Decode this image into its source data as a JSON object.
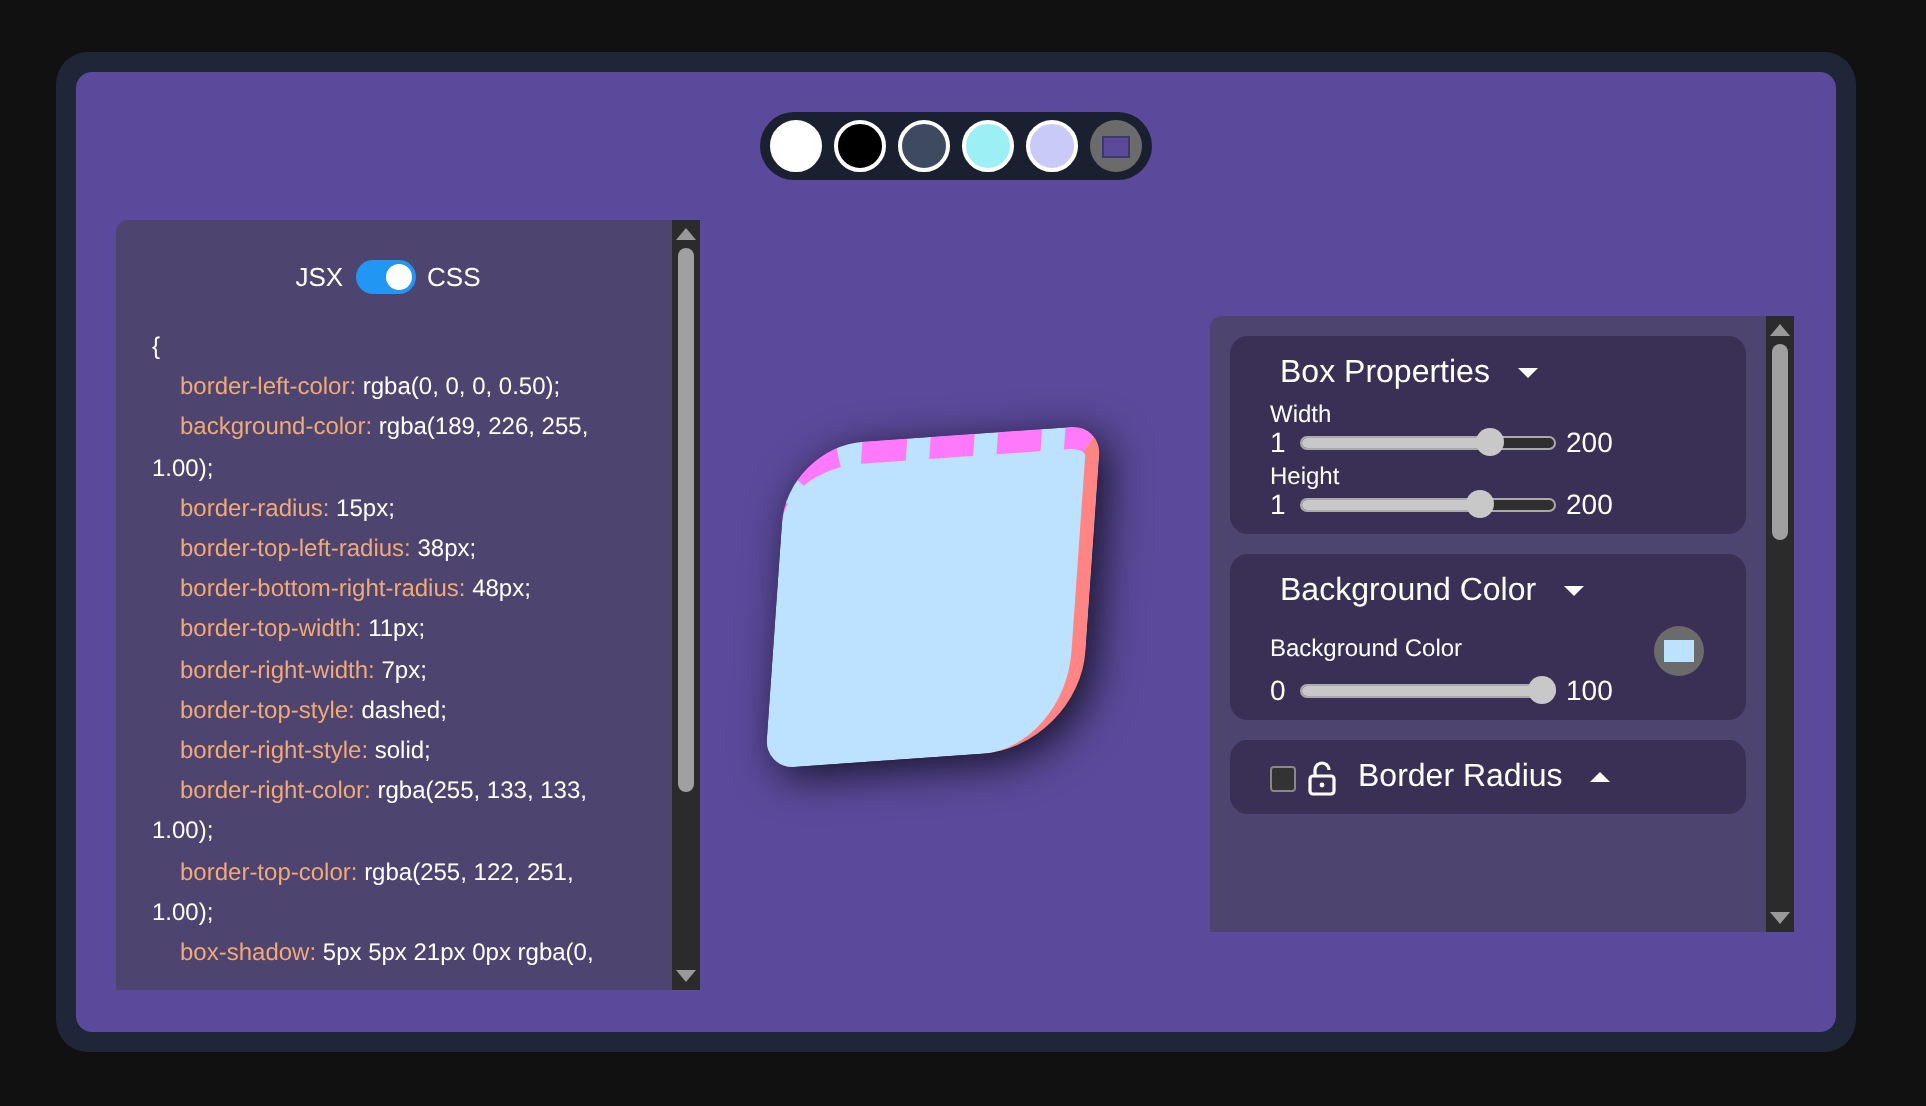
{
  "swatches": [
    {
      "color": "#ffffff"
    },
    {
      "color": "#000000"
    },
    {
      "color": "#3e4a60"
    },
    {
      "color": "#9cf0f5"
    },
    {
      "color": "#c9caf7"
    }
  ],
  "code_panel": {
    "toggle": {
      "left_label": "JSX",
      "right_label": "CSS",
      "on": true
    },
    "open_brace": "{",
    "lines": [
      {
        "property": "border-left-color:",
        "value": "rgba(0, 0, 0, 0.50);"
      },
      {
        "property": "background-color:",
        "value": "rgba(189, 226, 255, 1.00);"
      },
      {
        "property": "border-radius:",
        "value": "15px;"
      },
      {
        "property": "border-top-left-radius:",
        "value": "38px;"
      },
      {
        "property": "border-bottom-right-radius:",
        "value": "48px;"
      },
      {
        "property": "border-top-width:",
        "value": "11px;"
      },
      {
        "property": "border-right-width:",
        "value": "7px;"
      },
      {
        "property": "border-top-style:",
        "value": "dashed;"
      },
      {
        "property": "border-right-style:",
        "value": "solid;"
      },
      {
        "property": "border-right-color:",
        "value": "rgba(255, 133, 133, 1.00);"
      },
      {
        "property": "border-top-color:",
        "value": "rgba(255, 122, 251, 1.00);"
      },
      {
        "property": "box-shadow:",
        "value": "5px 5px 21px 0px rgba(0,"
      }
    ]
  },
  "sections": [
    {
      "title": "Box Properties",
      "expanded": true,
      "sliders": [
        {
          "label": "Width",
          "min": "1",
          "max": "200",
          "level": 0.77
        },
        {
          "label": "Height",
          "min": "1",
          "max": "200",
          "level": 0.73
        }
      ]
    },
    {
      "title": "Background Color",
      "expanded": true,
      "sliders": [
        {
          "label": "Background Color",
          "min": "0",
          "max": "100",
          "level": 1.0,
          "swatch": true
        }
      ]
    },
    {
      "title": "Border Radius",
      "expanded": false,
      "checked": false,
      "locked": false
    }
  ]
}
